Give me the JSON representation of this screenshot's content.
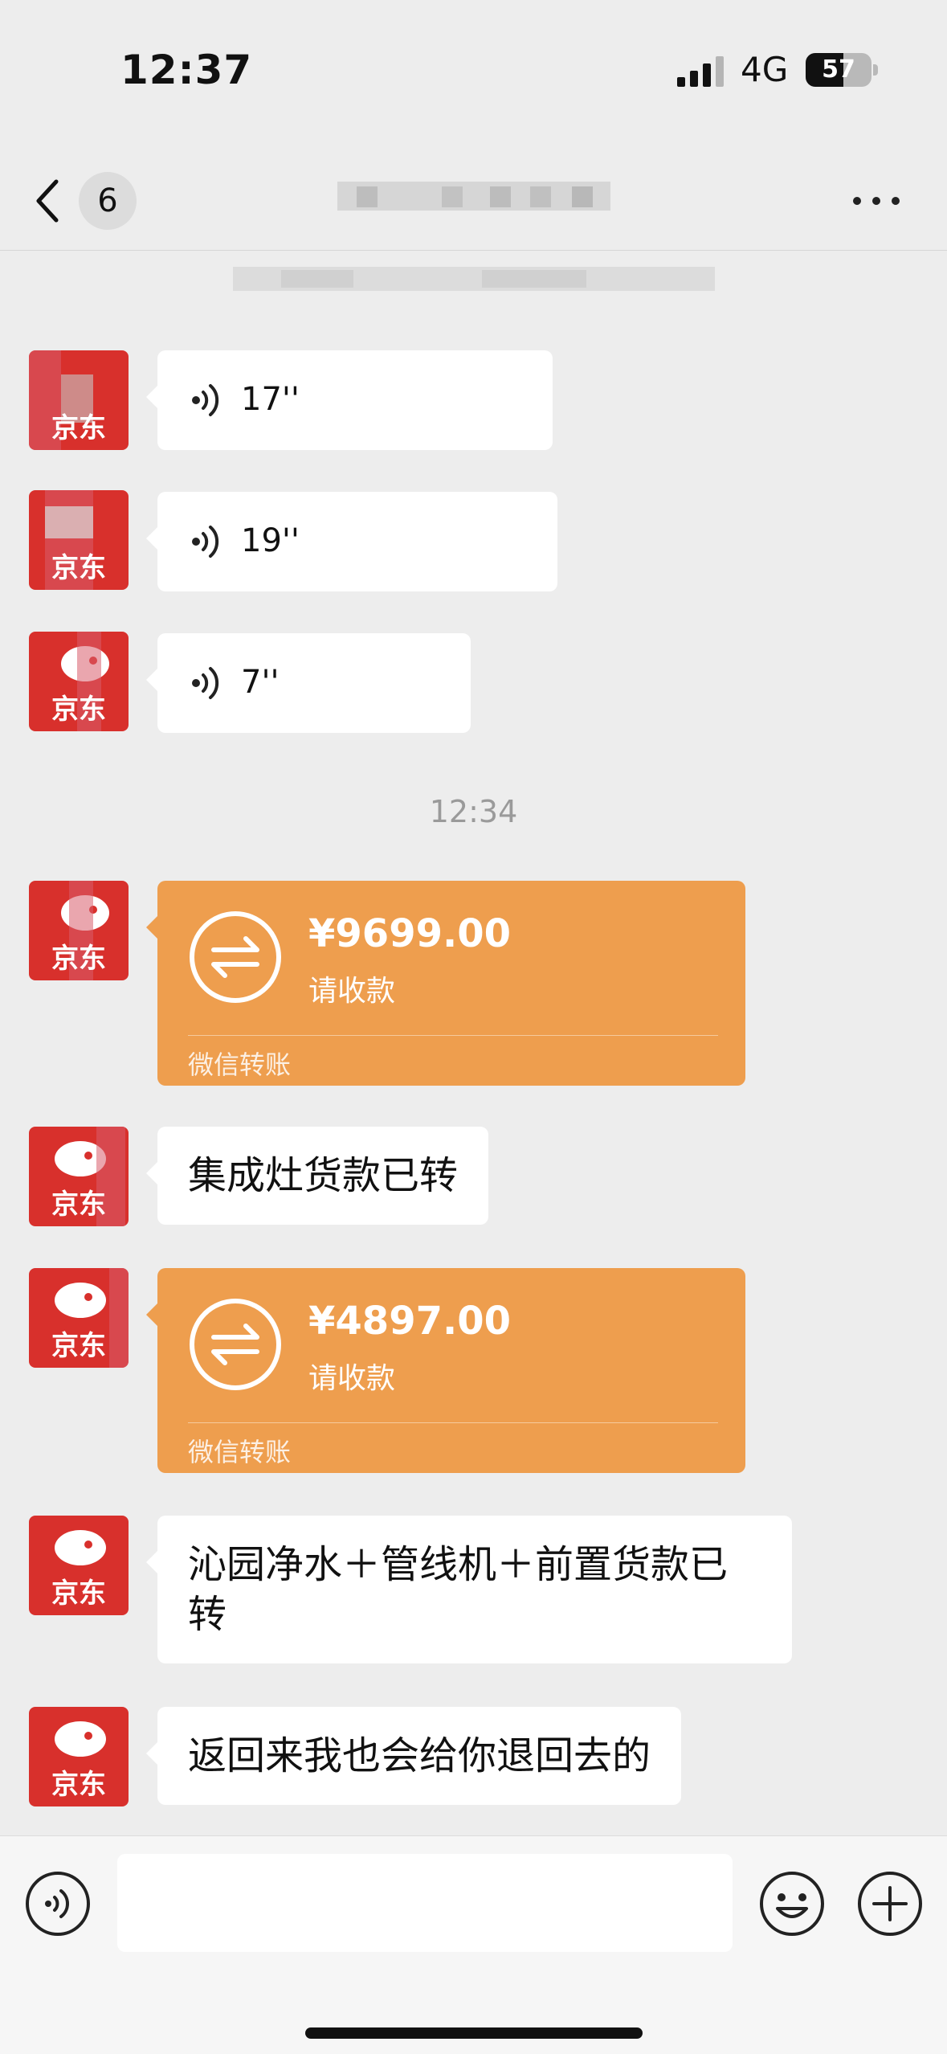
{
  "status_bar": {
    "time": "12:37",
    "network": "4G",
    "battery": "57",
    "battery_level": 0.57
  },
  "nav": {
    "unread_count": "6"
  },
  "time_divider": "12:34",
  "avatar_label": "京东",
  "voice_messages": [
    {
      "duration": "17''"
    },
    {
      "duration": "19''"
    },
    {
      "duration": "7''"
    }
  ],
  "transfers": [
    {
      "amount": "¥9699.00",
      "status": "请收款",
      "label": "微信转账"
    },
    {
      "amount": "¥4897.00",
      "status": "请收款",
      "label": "微信转账"
    }
  ],
  "text_messages": [
    {
      "text": "集成灶货款已转"
    },
    {
      "text": "沁园净水＋管线机＋前置货款已转"
    },
    {
      "text": "返回来我也会给你退回去的"
    }
  ],
  "colors": {
    "transfer": "#ee9e4e",
    "avatar": "#d8302c",
    "background": "#ededed"
  },
  "icons": [
    "back-arrow-icon",
    "more-icon",
    "voice-wave-icon",
    "transfer-arrows-icon",
    "emoji-icon",
    "plus-icon"
  ]
}
